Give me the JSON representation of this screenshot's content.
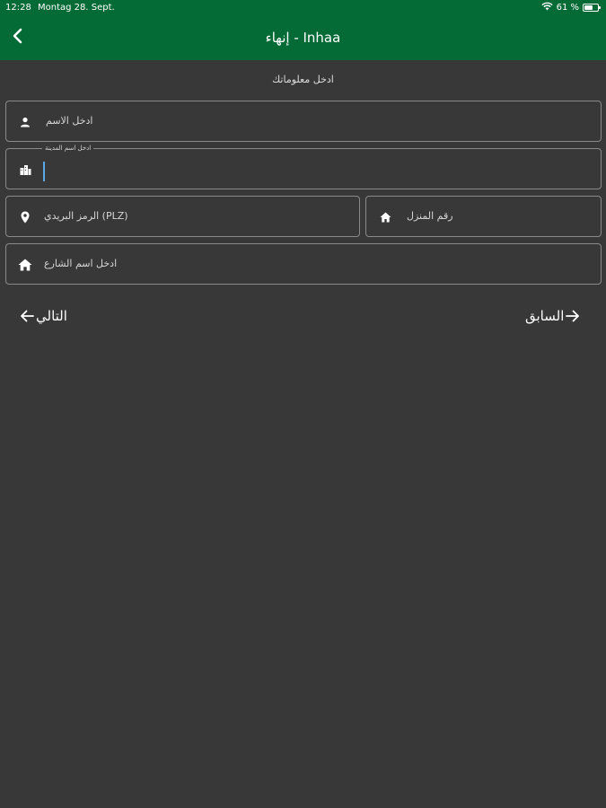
{
  "status_bar": {
    "time": "12:28",
    "date": "Montag 28. Sept.",
    "battery": "61 %",
    "battery_level": 0.61
  },
  "header": {
    "title": "إنهاء - Inhaa"
  },
  "form": {
    "subtitle": "ادخل معلوماتك",
    "name_placeholder": "ادخل الاسم",
    "city_label": "ادخل اسم المدينة",
    "postal_code_placeholder": "الرمز البريدي (PLZ)",
    "house_number_placeholder": "رقم المنزل",
    "street_placeholder": "ادخل اسم الشارع"
  },
  "navigation": {
    "next_label": "التالي",
    "previous_label": "السابق"
  },
  "colors": {
    "header_bg": "#046a36",
    "page_bg": "#383838",
    "cursor": "#5aa9e6"
  }
}
